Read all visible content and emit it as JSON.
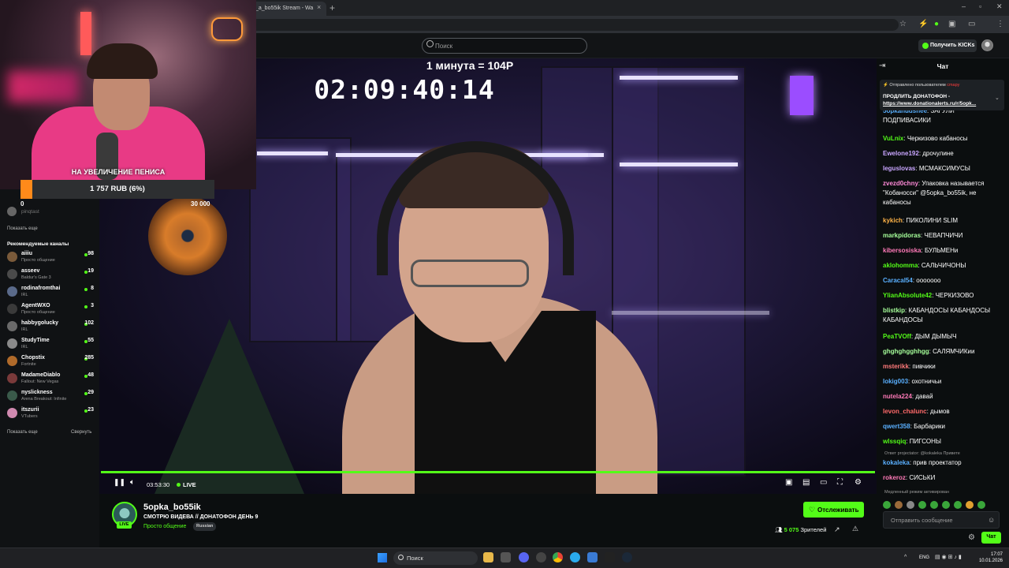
{
  "browser": {
    "tab_title": "_a_bo55ik Stream - Wa",
    "new_tab": "+",
    "window_controls": [
      "–",
      "▫",
      "✕"
    ]
  },
  "header": {
    "search_placeholder": "Поиск",
    "kicks_label": "Получить KICKs"
  },
  "overlay": {
    "goal_title": "НА УВЕЛИЧЕНИЕ ПЕНИСА",
    "goal_amount": "1 757 RUB (6%)",
    "goal_progress": 0.06,
    "goal_start": "0",
    "goal_target": "30 000",
    "timer_label": "1 минута = 104Р",
    "timer": "02:09:40:14"
  },
  "sidebar": {
    "following_user": "pinqtast",
    "show_more_1": "Показать еще",
    "recommended_title": "Рекомендуемые каналы",
    "channels": [
      {
        "name": "aiiiu",
        "category": "Просто общение",
        "viewers": "98",
        "color": "#7a5a3a"
      },
      {
        "name": "asseev",
        "category": "Baldur's Gate 3",
        "viewers": "19",
        "color": "#4a4a4a"
      },
      {
        "name": "rodinafromthai",
        "category": "IRL",
        "viewers": "8",
        "color": "#5a6a8a"
      },
      {
        "name": "AgentWXO",
        "category": "Просто общение",
        "viewers": "3",
        "color": "#3a3a3a"
      },
      {
        "name": "habbygolucky",
        "category": "IRL",
        "viewers": "102",
        "color": "#6a6a6a"
      },
      {
        "name": "StudyTime",
        "category": "IRL",
        "viewers": "55",
        "color": "#8a8a8a"
      },
      {
        "name": "Chopstix",
        "category": "Fortnite",
        "viewers": "285",
        "color": "#b06a2a"
      },
      {
        "name": "MadameDiablo",
        "category": "Fallout: New Vegas",
        "viewers": "48",
        "color": "#7a3a3a"
      },
      {
        "name": "nyslickness",
        "category": "Arena Breakout: Infinite",
        "viewers": "29",
        "color": "#3a5a4a"
      },
      {
        "name": "itszurii",
        "category": "VTubers",
        "viewers": "23",
        "color": "#d08ab0"
      }
    ],
    "show_more_2": "Показать еще",
    "collapse": "Свернуть"
  },
  "player": {
    "current_time": "03:53:30",
    "live_label": "LIVE"
  },
  "stream": {
    "streamer": "5opka_bo55ik",
    "live_badge": "LIVE",
    "title": "СМОТРЮ ВИДЕВА // ДОНАТОФОН ДЕНЬ 9",
    "category": "Просто общение",
    "language": "Russian",
    "follow_label": "Отслеживать",
    "viewers_count": "5 075",
    "viewers_label": "Зрителей"
  },
  "chat": {
    "header": "Чат",
    "pinned_by_prefix": "Отправлено пользователем",
    "pinned_by_user": "cmapy",
    "pinned_message": "ПРОДЛИТЬ ДОНАТОФОН -",
    "pinned_link": "https://www.donationalerts.ru/r/5opk...",
    "messages": [
      {
        "user": "5opkanudsnee",
        "text": "ЗАГУЛИ ПОДПИВАСИКИ",
        "color": "#5ab0ff"
      },
      {
        "user": "VuLnix",
        "text": "Черкизово кабаносы",
        "color": "#53fc18"
      },
      {
        "user": "Ewelone192",
        "text": "дрочулине",
        "color": "#c9a6ff"
      },
      {
        "user": "leguslovas",
        "text": "МСМАКСИМУСЫ",
        "color": "#c9a6ff"
      },
      {
        "user": "zvezd0chny",
        "text": "Упаковка называется \"Кобаносси\" @5opka_bo55ik, не кабаносы",
        "color": "#ff8ad8"
      },
      {
        "user": "kykich",
        "text": "ПИКОЛИНИ SLIM",
        "color": "#ffb347"
      },
      {
        "user": "markpidoras",
        "text": "ЧЕВАПЧИЧИ",
        "color": "#a6ff9a"
      },
      {
        "user": "kibersosiska",
        "text": "БУЛЬМЕНи",
        "color": "#ff7ab8"
      },
      {
        "user": "aklohomma",
        "text": "САЛЬЧИЧОНЫ",
        "color": "#53fc18"
      },
      {
        "user": "Caracal54",
        "text": "ооооооо",
        "color": "#5ab0ff"
      },
      {
        "user": "YlianAbsolute42",
        "text": "ЧЕРКИЗОВО",
        "color": "#53fc18"
      },
      {
        "user": "blistkip",
        "text": "КАБАНДОСЫ КАБАНДОСЫ КАБАНДОСЫ",
        "color": "#a6ff9a"
      },
      {
        "user": "PeaTVOff",
        "text": "ДЫМ ДЫМЫЧ",
        "color": "#53fc18"
      },
      {
        "user": "ghghghgghhgg",
        "text": "САЛЯМЧИКии",
        "color": "#a6ff9a"
      },
      {
        "user": "msterikk",
        "text": "пивчики",
        "color": "#ff7a7a"
      },
      {
        "user": "lokig003",
        "text": "охотничьи",
        "color": "#5ab0ff"
      },
      {
        "user": "nutela224",
        "text": "давай",
        "color": "#ff7ab8"
      },
      {
        "user": "levon_chalunc",
        "text": "дымов",
        "color": "#ff6a6a"
      },
      {
        "user": "qwert358",
        "text": "Барбарики",
        "color": "#5ab0ff"
      },
      {
        "user": "wlssqiq",
        "text": "ПИГСОНЫ",
        "color": "#53fc18"
      }
    ],
    "reply_context": "Ответ projectator: @kokaleka Привете",
    "reply_message": {
      "user": "kokaleka",
      "text": "прив проектатор",
      "color": "#5ab0ff"
    },
    "last_message": {
      "user": "rokeroz",
      "text": "СИСЬКИ",
      "color": "#ff7ab8"
    },
    "slow_mode": "Медленный режим активирован",
    "input_placeholder": "Отправить сообщение",
    "send_label": "Чат"
  },
  "taskbar": {
    "search_label": "Поиск",
    "language": "ENG",
    "time": "17:07",
    "date": "10.01.2026"
  }
}
